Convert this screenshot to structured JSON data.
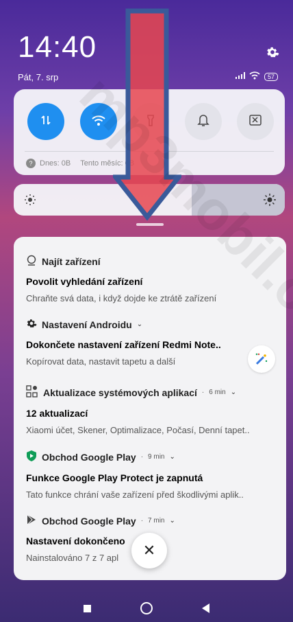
{
  "status_bar": {
    "time": "14:40",
    "date": "Pát, 7. srp",
    "battery": "57"
  },
  "quick_settings": {
    "toggles": [
      {
        "name": "mobile-data",
        "state": "on"
      },
      {
        "name": "wifi",
        "state": "on"
      },
      {
        "name": "flashlight",
        "state": "off"
      },
      {
        "name": "silent",
        "state": "off"
      },
      {
        "name": "screenshot",
        "state": "off"
      }
    ],
    "data_today": "Dnes: 0B",
    "data_month": "Tento měsíc: 0B"
  },
  "brightness_level": 0.65,
  "notifications": [
    {
      "app": "Najít zařízení",
      "time": "",
      "title": "Povolit vyhledání zařízení",
      "body": "Chraňte svá data, i když dojde ke ztrátě zařízení"
    },
    {
      "app": "Nastavení Androidu",
      "time": "",
      "title": "Dokončete nastavení zařízení Redmi Note..",
      "body": "Kopírovat data, nastavit tapetu a další"
    },
    {
      "app": "Aktualizace systémových aplikací",
      "time": "6 min",
      "title": "12 aktualizací",
      "body": "Xiaomi účet, Skener, Optimalizace, Počasí, Denní tapet.."
    },
    {
      "app": "Obchod Google Play",
      "time": "9 min",
      "title": "Funkce Google Play Protect je zapnutá",
      "body": "Tato funkce chrání vaše zařízení před škodlivými aplik.."
    },
    {
      "app": "Obchod Google Play",
      "time": "7 min",
      "title": "Nastavení dokončeno",
      "body": "Nainstalováno 7 z 7 apl"
    }
  ],
  "colors": {
    "accent": "#1f8ff0",
    "arrow": "#e05560",
    "arrow_outline": "#3a5a9a"
  },
  "watermark": "mp3mobil.cz",
  "separator": "·"
}
